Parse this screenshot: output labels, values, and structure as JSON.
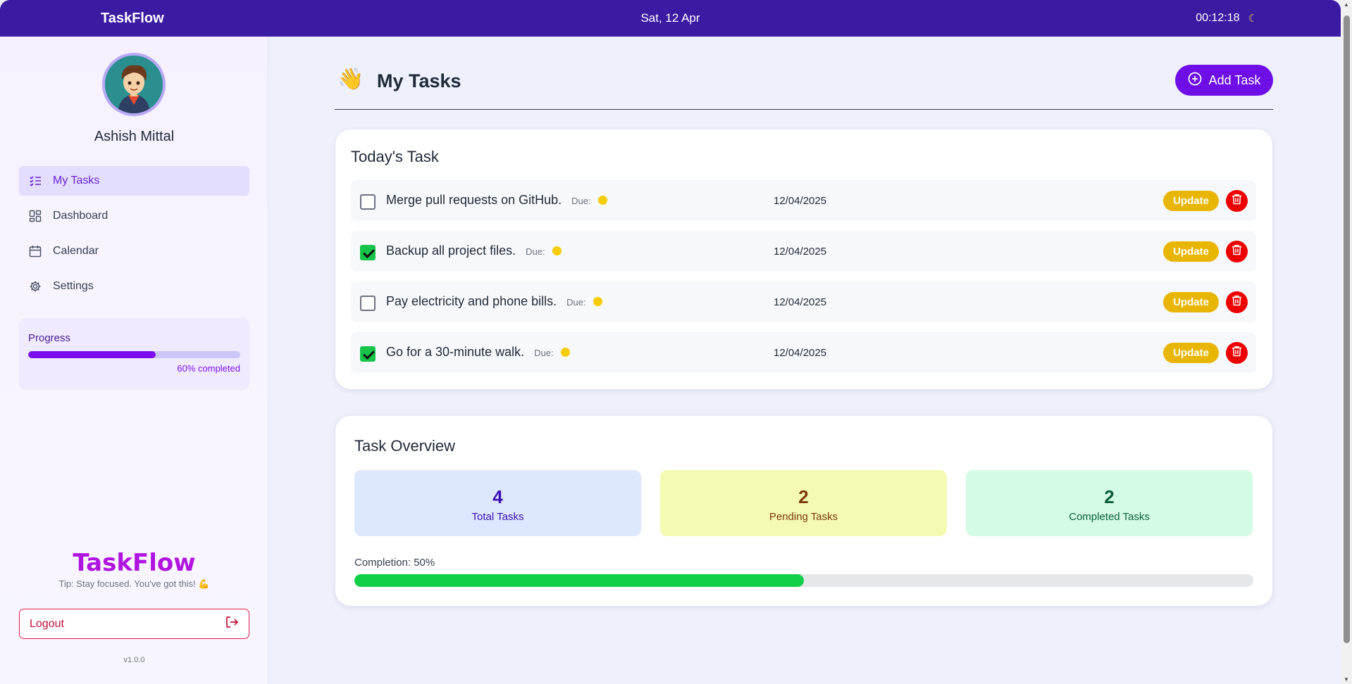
{
  "topbar": {
    "brand": "TaskFlow",
    "date": "Sat, 12 Apr",
    "time": "00:12:18",
    "theme_icon": "moon-icon"
  },
  "user": {
    "name": "Ashish Mittal"
  },
  "sidebar": {
    "items": [
      {
        "label": "My Tasks",
        "icon": "checklist-icon",
        "active": true
      },
      {
        "label": "Dashboard",
        "icon": "grid-icon",
        "active": false
      },
      {
        "label": "Calendar",
        "icon": "calendar-icon",
        "active": false
      },
      {
        "label": "Settings",
        "icon": "gear-icon",
        "active": false
      }
    ],
    "progress": {
      "label": "Progress",
      "value": 0.6,
      "text": "60% completed"
    },
    "brand": "TaskFlow",
    "tip": "Tip: Stay focused. You've got this! 💪",
    "logout": "Logout",
    "version": "v1.0.0"
  },
  "main": {
    "title": "My Tasks",
    "add_button": "Add Task",
    "today": {
      "title": "Today's Task",
      "due_label": "Due:",
      "update_label": "Update",
      "tasks": [
        {
          "name": "Merge pull requests on GitHub.",
          "date": "12/04/2025",
          "done": false
        },
        {
          "name": "Backup all project files.",
          "date": "12/04/2025",
          "done": true
        },
        {
          "name": "Pay electricity and phone bills.",
          "date": "12/04/2025",
          "done": false
        },
        {
          "name": "Go for a 30-minute walk.",
          "date": "12/04/2025",
          "done": true
        }
      ]
    },
    "overview": {
      "title": "Task Overview",
      "total": {
        "value": "4",
        "label": "Total Tasks"
      },
      "pending": {
        "value": "2",
        "label": "Pending Tasks"
      },
      "completed": {
        "value": "2",
        "label": "Completed Tasks"
      },
      "completion_text": "Completion: 50%",
      "completion_value": 0.5
    }
  },
  "colors": {
    "accent": "#6d0fe6",
    "topbar": "#3c1ba3",
    "success": "#12cf48",
    "warning": "#e8b500",
    "danger": "#ee0000"
  }
}
